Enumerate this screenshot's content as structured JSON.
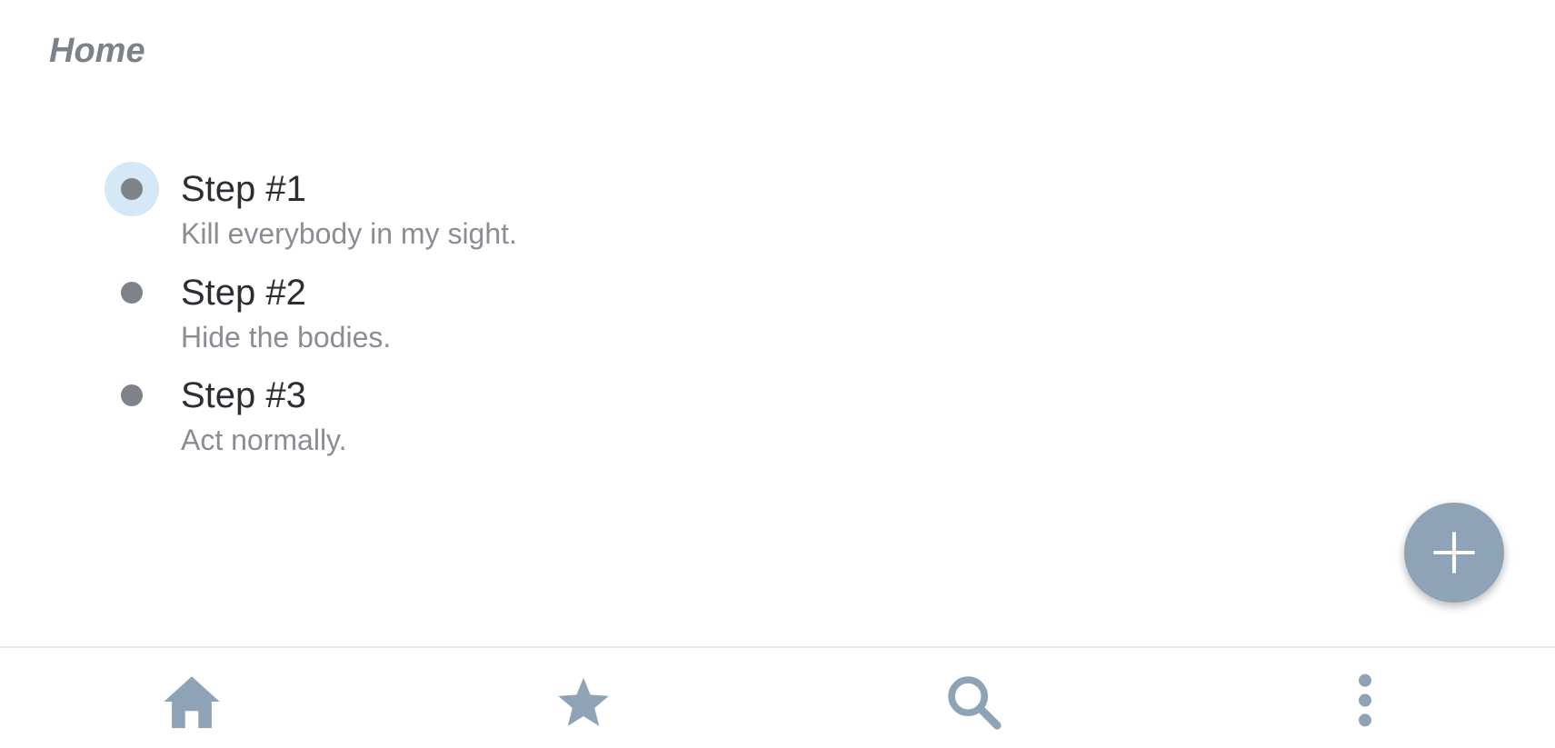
{
  "header": {
    "title": "Home"
  },
  "steps": [
    {
      "title": "Step #1",
      "description": "Kill everybody in my sight.",
      "selected": true
    },
    {
      "title": "Step #2",
      "description": "Hide the bodies.",
      "selected": false
    },
    {
      "title": "Step #3",
      "description": "Act normally.",
      "selected": false
    }
  ],
  "fab": {
    "icon": "plus-icon"
  },
  "bottom_nav": {
    "items": [
      {
        "icon": "home-icon"
      },
      {
        "icon": "star-icon"
      },
      {
        "icon": "search-icon"
      },
      {
        "icon": "more-vertical-icon"
      }
    ]
  },
  "colors": {
    "accent": "#8ea4b6",
    "selected_highlight": "#d4e8f6",
    "dot": "#7e8389",
    "primary_text": "#2b2e33",
    "secondary_text": "#8a8e94"
  }
}
